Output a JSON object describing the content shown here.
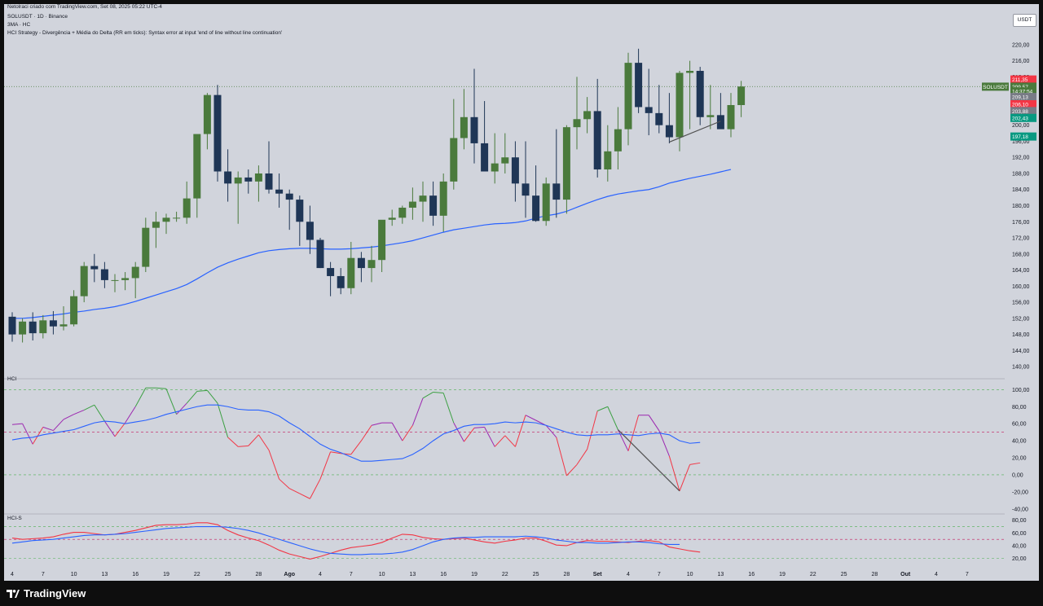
{
  "header": {
    "publisher_line": "Netolraci criado com TradingView.com, Set 08, 2025 05:22 UTC-4",
    "symbol_line": "SOLUSDT · 1D · Binance",
    "ma_line": "3MA · HC",
    "indicator_error_line": "HCI Strategy - Divergência + Média do Delta (RR em ticks): Syntax error at input 'end of line without line continuation'"
  },
  "currency_button": "USDT",
  "footer": {
    "logo_text": "TradingView"
  },
  "colors": {
    "background": "#d1d4dc",
    "bull": "#4a7a3c",
    "bear": "#1f3656",
    "ma": "#2962ff",
    "hci_green": "#3ca043",
    "hci_purple": "#9c27b0",
    "hci_red": "#f23645",
    "divergence": "#505050"
  },
  "chart_data": [
    {
      "type": "candlestick",
      "symbol": "SOLUSDT",
      "interval": "1D",
      "exchange": "Binance",
      "ylim": [
        138,
        222
      ],
      "y_ticks": [
        "220,00",
        "216,00",
        "212,00",
        "208,00",
        "204,00",
        "200,00",
        "196,00",
        "192,00",
        "188,00",
        "184,00",
        "180,00",
        "176,00",
        "172,00",
        "168,00",
        "164,00",
        "160,00",
        "156,00",
        "152,00",
        "148,00",
        "144,00",
        "140,00"
      ],
      "x_ticks": [
        "4",
        "7",
        "10",
        "13",
        "16",
        "19",
        "22",
        "25",
        "28",
        "Ago",
        "4",
        "7",
        "10",
        "13",
        "16",
        "19",
        "22",
        "25",
        "28",
        "Set",
        "4",
        "7",
        "10",
        "13",
        "16",
        "19",
        "22",
        "25",
        "28",
        "Out",
        "4",
        "7"
      ],
      "first_date": "2025-07-04",
      "ohlc": [
        [
          152.4,
          153.5,
          146.2,
          148.0
        ],
        [
          148.0,
          152.0,
          146.0,
          151.2
        ],
        [
          151.2,
          153.5,
          146.5,
          148.3
        ],
        [
          148.3,
          152.8,
          147.0,
          151.5
        ],
        [
          151.5,
          153.8,
          148.0,
          150.0
        ],
        [
          150.0,
          155.0,
          149.0,
          150.5
        ],
        [
          150.5,
          159.0,
          150.0,
          157.5
        ],
        [
          157.5,
          166.0,
          156.0,
          165.0
        ],
        [
          165.0,
          168.0,
          161.0,
          164.2
        ],
        [
          164.2,
          166.0,
          159.5,
          161.5
        ],
        [
          161.5,
          163.0,
          158.5,
          161.5
        ],
        [
          161.5,
          163.5,
          159.0,
          162.0
        ],
        [
          162.0,
          166.0,
          157.0,
          164.8
        ],
        [
          164.8,
          177.0,
          163.5,
          174.5
        ],
        [
          174.5,
          178.5,
          169.5,
          176.0
        ],
        [
          176.0,
          178.0,
          173.0,
          177.0
        ],
        [
          177.0,
          178.5,
          176.0,
          177.0
        ],
        [
          177.0,
          186.0,
          175.5,
          181.8
        ],
        [
          181.8,
          190.0,
          177.0,
          197.8
        ],
        [
          197.8,
          208.0,
          194.0,
          207.5
        ],
        [
          207.5,
          210.0,
          186.0,
          188.5
        ],
        [
          188.5,
          194.0,
          181.0,
          185.5
        ],
        [
          185.5,
          188.5,
          175.5,
          187.0
        ],
        [
          187.0,
          189.0,
          183.0,
          186.0
        ],
        [
          186.0,
          190.0,
          181.0,
          188.0
        ],
        [
          188.0,
          196.0,
          183.0,
          184.0
        ],
        [
          184.0,
          188.0,
          179.5,
          183.0
        ],
        [
          183.0,
          184.0,
          174.0,
          181.5
        ],
        [
          181.5,
          182.5,
          170.0,
          176.0
        ],
        [
          176.0,
          180.0,
          168.0,
          171.5
        ],
        [
          171.5,
          172.0,
          164.5,
          164.5
        ],
        [
          164.5,
          166.0,
          157.5,
          162.5
        ],
        [
          162.5,
          164.5,
          158.0,
          159.5
        ],
        [
          159.5,
          171.0,
          158.0,
          167.0
        ],
        [
          167.0,
          168.5,
          161.0,
          164.5
        ],
        [
          164.5,
          170.0,
          161.0,
          166.5
        ],
        [
          166.5,
          172.0,
          163.5,
          176.5
        ],
        [
          176.5,
          179.0,
          175.0,
          177.0
        ],
        [
          177.0,
          180.0,
          175.5,
          179.5
        ],
        [
          179.5,
          184.5,
          176.5,
          181.0
        ],
        [
          181.0,
          186.0,
          176.0,
          182.5
        ],
        [
          182.5,
          186.0,
          175.0,
          177.5
        ],
        [
          177.5,
          188.0,
          173.5,
          186.0
        ],
        [
          186.0,
          206.5,
          184.0,
          196.8
        ],
        [
          196.8,
          209.0,
          194.0,
          202.0
        ],
        [
          202.0,
          214.0,
          190.5,
          195.5
        ],
        [
          195.5,
          206.0,
          190.5,
          188.5
        ],
        [
          188.5,
          198.0,
          185.5,
          190.5
        ],
        [
          190.5,
          198.0,
          188.0,
          192.0
        ],
        [
          192.0,
          196.0,
          181.0,
          185.5
        ],
        [
          185.5,
          196.0,
          177.0,
          182.5
        ],
        [
          182.5,
          190.0,
          176.0,
          176.2
        ],
        [
          176.2,
          187.0,
          175.0,
          185.5
        ],
        [
          185.5,
          199.0,
          177.0,
          181.5
        ],
        [
          181.5,
          200.0,
          178.0,
          199.5
        ],
        [
          199.5,
          212.0,
          194.0,
          201.5
        ],
        [
          201.5,
          207.0,
          198.0,
          203.5
        ],
        [
          203.5,
          211.5,
          187.0,
          189.0
        ],
        [
          189.0,
          200.0,
          186.0,
          193.5
        ],
        [
          193.5,
          204.5,
          189.0,
          199.0
        ],
        [
          199.0,
          218.0,
          195.0,
          215.5
        ],
        [
          215.5,
          219.0,
          203.0,
          204.5
        ],
        [
          204.5,
          214.0,
          197.5,
          203.0
        ],
        [
          203.0,
          210.0,
          198.0,
          200.0
        ],
        [
          200.0,
          208.0,
          195.5,
          197.0
        ],
        [
          197.0,
          213.5,
          193.5,
          213.0
        ],
        [
          213.0,
          216.0,
          199.0,
          213.5
        ],
        [
          213.5,
          214.5,
          200.0,
          202.0
        ],
        [
          202.0,
          210.0,
          199.0,
          202.5
        ],
        [
          202.5,
          208.0,
          201.0,
          199.0
        ],
        [
          199.0,
          208.0,
          197.0,
          205.0
        ],
        [
          205.0,
          211.0,
          202.0,
          209.6
        ]
      ],
      "ma": {
        "label": "3MA",
        "values": [
          152.0,
          152.0,
          152.2,
          152.5,
          152.8,
          153.1,
          153.5,
          153.8,
          154.2,
          154.5,
          154.9,
          155.5,
          156.2,
          157.0,
          157.8,
          158.6,
          159.4,
          160.4,
          161.8,
          163.3,
          164.7,
          165.8,
          166.7,
          167.5,
          168.3,
          168.8,
          169.1,
          169.3,
          169.4,
          169.4,
          169.3,
          169.2,
          169.2,
          169.3,
          169.5,
          169.7,
          170.0,
          170.4,
          170.8,
          171.3,
          172.0,
          172.7,
          173.4,
          174.0,
          174.4,
          174.8,
          175.2,
          175.5,
          175.6,
          175.8,
          176.2,
          176.9,
          177.5,
          177.9,
          178.6,
          179.6,
          180.6,
          181.5,
          182.3,
          182.9,
          183.3,
          183.7,
          184.0,
          184.7,
          185.6,
          186.2,
          186.8,
          187.3,
          187.8,
          188.4,
          189.0
        ]
      },
      "price_labels": [
        {
          "text": "211,35",
          "value": 211.35,
          "color": "#f23645"
        },
        {
          "text": "SOLUSDT",
          "value": 209.57,
          "color": "#4a7a3c"
        },
        {
          "text": "209,57",
          "value": 209.57,
          "color": "#4a7a3c"
        },
        {
          "text": "14:37:54",
          "value": 208.4,
          "color": "#4a7a3c"
        },
        {
          "text": "209,13",
          "value": 207.0,
          "color": "#787b86"
        },
        {
          "text": "206,10",
          "value": 205.2,
          "color": "#f23645"
        },
        {
          "text": "203,88",
          "value": 203.5,
          "color": "#787b86"
        },
        {
          "text": "202,43",
          "value": 201.8,
          "color": "#089981"
        },
        {
          "text": "197,18",
          "value": 197.18,
          "color": "#089981"
        }
      ],
      "divergence_line": {
        "from": [
          64,
          195.8
        ],
        "to": [
          69,
          201.0
        ]
      }
    },
    {
      "type": "line",
      "title": "HCI",
      "ylim": [
        -44,
        107
      ],
      "y_ticks": [
        "100,00",
        "80,00",
        "60,00",
        "40,00",
        "20,00",
        "0,00",
        "-20,00",
        "-40,00"
      ],
      "levels": [
        100,
        50,
        0
      ],
      "series": [
        {
          "values": [
            59,
            60,
            36,
            56,
            52,
            65,
            71,
            76,
            82,
            63,
            45,
            61,
            80,
            102,
            102,
            101,
            71,
            84,
            98,
            99,
            84,
            44,
            33,
            34,
            47,
            29,
            -5,
            -16,
            -22,
            -28,
            -5,
            27,
            25,
            24,
            40,
            58,
            61,
            61,
            40,
            58,
            90,
            97,
            96,
            61,
            39,
            55,
            56,
            33,
            46,
            33,
            70,
            64,
            58,
            44,
            -1,
            12,
            30,
            75,
            80,
            53,
            28,
            70,
            70,
            52,
            22,
            -19,
            12,
            14
          ]
        },
        {
          "values": [
            41,
            43,
            44,
            47,
            49,
            51,
            53,
            57,
            61,
            63,
            62,
            60,
            62,
            64,
            67,
            71,
            74,
            77,
            80,
            82,
            82,
            80,
            77,
            76,
            76,
            74,
            69,
            61,
            54,
            45,
            36,
            30,
            26,
            21,
            16,
            16,
            17,
            18,
            19,
            24,
            31,
            40,
            48,
            52,
            57,
            59,
            59,
            60,
            62,
            61,
            62,
            61,
            58,
            54,
            50,
            47,
            46,
            47,
            47,
            48,
            47,
            46,
            48,
            49,
            47,
            40,
            37,
            38
          ]
        }
      ]
    },
    {
      "type": "line",
      "title": "HCI-S",
      "ylim": [
        8,
        86
      ],
      "y_ticks": [
        "80,00",
        "60,00",
        "40,00",
        "20,00"
      ],
      "levels": [
        70,
        50,
        20
      ],
      "series": [
        {
          "values": [
            52,
            50,
            51,
            52,
            54,
            58,
            61,
            61,
            59,
            57,
            58,
            61,
            64,
            68,
            72,
            73,
            73,
            74,
            76,
            76,
            73,
            64,
            57,
            52,
            48,
            41,
            33,
            27,
            23,
            19,
            23,
            28,
            33,
            37,
            39,
            41,
            45,
            52,
            58,
            57,
            53,
            51,
            50,
            51,
            52,
            49,
            46,
            44,
            47,
            49,
            52,
            52,
            47,
            41,
            40,
            45,
            48,
            47,
            47,
            46,
            45,
            47,
            48,
            46,
            38,
            35,
            32,
            30
          ]
        },
        {
          "values": [
            44,
            46,
            48,
            49,
            50,
            52,
            54,
            56,
            57,
            57,
            58,
            59,
            61,
            63,
            65,
            67,
            68,
            69,
            70,
            70,
            70,
            69,
            67,
            64,
            60,
            55,
            50,
            45,
            40,
            35,
            31,
            28,
            27,
            26,
            26,
            27,
            27,
            28,
            30,
            34,
            40,
            46,
            50,
            52,
            53,
            53,
            54,
            54,
            54,
            54,
            55,
            54,
            52,
            49,
            47,
            45,
            45,
            44,
            44,
            45,
            46,
            46,
            45,
            43,
            42,
            42
          ]
        }
      ]
    }
  ]
}
